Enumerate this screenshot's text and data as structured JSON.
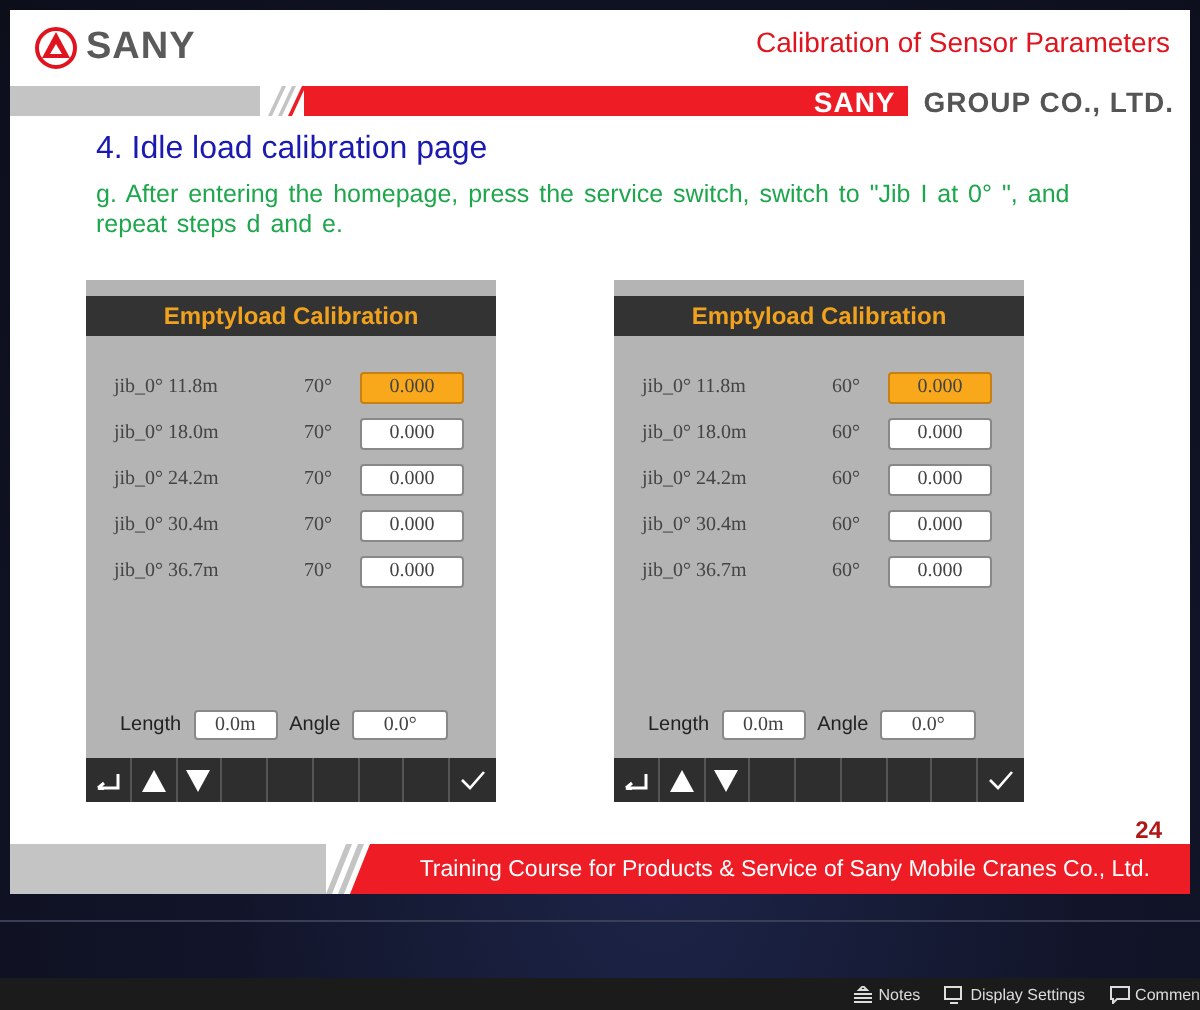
{
  "slide": {
    "logo_text": "SANY",
    "title": "Calibration of Sensor Parameters",
    "band_brand": "SANY",
    "band_company": "GROUP CO., LTD.",
    "heading": "4. Idle load calibration page",
    "paragraph": "g. After entering the homepage, press the service switch, switch to \"Jib I at 0°  \", and repeat steps d and e.",
    "page_number": "24",
    "footer": "Training Course for Products & Service of Sany Mobile Cranes Co., Ltd.",
    "panels": [
      {
        "title": "Emptyload Calibration",
        "rows": [
          {
            "label": "jib_0° 11.8m",
            "angle": "70°",
            "value": "0.000",
            "selected": true
          },
          {
            "label": "jib_0° 18.0m",
            "angle": "70°",
            "value": "0.000",
            "selected": false
          },
          {
            "label": "jib_0° 24.2m",
            "angle": "70°",
            "value": "0.000",
            "selected": false
          },
          {
            "label": "jib_0° 30.4m",
            "angle": "70°",
            "value": "0.000",
            "selected": false
          },
          {
            "label": "jib_0° 36.7m",
            "angle": "70°",
            "value": "0.000",
            "selected": false
          }
        ],
        "length_label": "Length",
        "length_value": "0.0m",
        "angle_label": "Angle",
        "angle_value": "0.0°",
        "toolbar": [
          {
            "kind": "back"
          },
          {
            "kind": "up"
          },
          {
            "kind": "down"
          },
          {
            "kind": "blank"
          },
          {
            "kind": "blank"
          },
          {
            "kind": "blank"
          },
          {
            "kind": "blank"
          },
          {
            "kind": "blank"
          },
          {
            "kind": "confirm"
          }
        ]
      },
      {
        "title": "Emptyload Calibration",
        "rows": [
          {
            "label": "jib_0° 11.8m",
            "angle": "60°",
            "value": "0.000",
            "selected": true
          },
          {
            "label": "jib_0° 18.0m",
            "angle": "60°",
            "value": "0.000",
            "selected": false
          },
          {
            "label": "jib_0° 24.2m",
            "angle": "60°",
            "value": "0.000",
            "selected": false
          },
          {
            "label": "jib_0° 30.4m",
            "angle": "60°",
            "value": "0.000",
            "selected": false
          },
          {
            "label": "jib_0° 36.7m",
            "angle": "60°",
            "value": "0.000",
            "selected": false
          }
        ],
        "length_label": "Length",
        "length_value": "0.0m",
        "angle_label": "Angle",
        "angle_value": "0.0°",
        "toolbar": [
          {
            "kind": "back"
          },
          {
            "kind": "up"
          },
          {
            "kind": "down"
          },
          {
            "kind": "blank"
          },
          {
            "kind": "blank"
          },
          {
            "kind": "blank"
          },
          {
            "kind": "blank"
          },
          {
            "kind": "blank"
          },
          {
            "kind": "confirm"
          }
        ]
      }
    ]
  },
  "status_bar": [
    {
      "kind": "notes",
      "label": "Notes"
    },
    {
      "kind": "display",
      "label": "Display Settings"
    },
    {
      "kind": "comments",
      "label": "Commen"
    }
  ]
}
